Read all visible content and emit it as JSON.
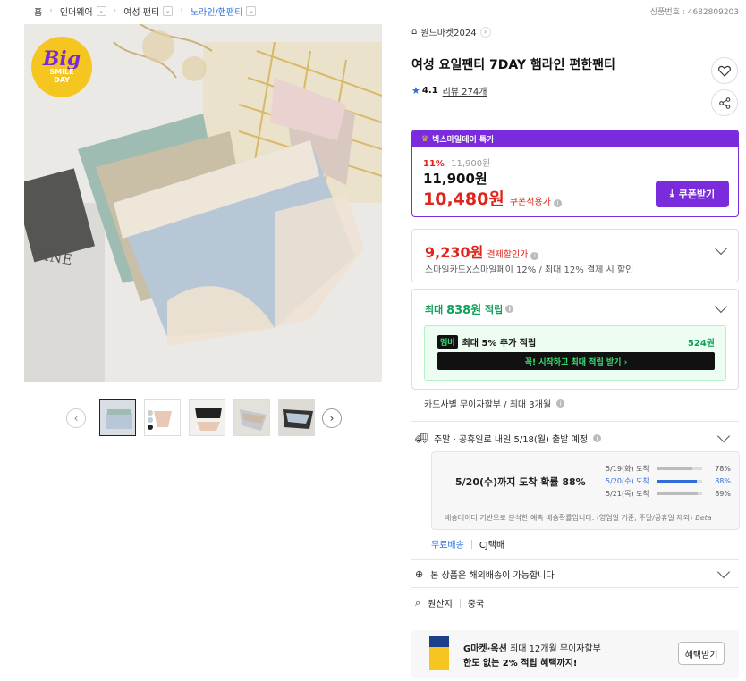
{
  "breadcrumb": [
    {
      "label": "홈"
    },
    {
      "label": "인더웨어"
    },
    {
      "label": "여성 팬티"
    },
    {
      "label": "노라인/햄팬티"
    }
  ],
  "product_number": "상품번호 : 4682809203",
  "badge": {
    "big": "Big",
    "line1": "SMILE",
    "line2": "DAY"
  },
  "shop": {
    "name": "원드마켓2024"
  },
  "title": "여성 요일팬티 7DAY 햄라인 편한팬티",
  "rating": {
    "score": "4.1",
    "reviews": "리뷰 274개"
  },
  "deal": {
    "header": "빅스마일데이 특가",
    "discount": "11%",
    "original": "11,900원",
    "price": "11,900원",
    "coupon_price": "10,480원",
    "coupon_label": "쿠폰적용가",
    "coupon_button": "쿠폰받기"
  },
  "payment": {
    "price": "9,230원",
    "label": "결제할인가",
    "desc": "스마일카드X스마일페이 12% / 최대 12% 결제 시 할인"
  },
  "points": {
    "prefix": "최대",
    "amount": "838원",
    "suffix": "적립",
    "member_logo": "멤버",
    "member_text": "최대 5% 추가 적립",
    "member_points": "524원",
    "member_button": "꼭! 시작하고 최대 적립 받기  ›"
  },
  "card_installment": "카드사별 무이자할부 / 최대 3개월",
  "shipping": {
    "headline": "주말 · 공휴일로 내일 5/18(월) 출발 예정",
    "probability": "5/20(수)까지 도착 확률 88%",
    "rows": [
      {
        "date": "5/19(화) 도착",
        "pct": "78%",
        "value": 0.78
      },
      {
        "date": "5/20(수) 도착",
        "pct": "88%",
        "value": 0.88
      },
      {
        "date": "5/21(목) 도착",
        "pct": "89%",
        "value": 0.89
      }
    ],
    "note": "배송데이터 기반으로 분석한 예측 배송확률입니다. (영업일 기준, 주말/공휴일 제외)",
    "beta": "Beta",
    "free": "무료배송",
    "carrier": "CJ택배"
  },
  "overseas": "본 상품은 해외배송이 가능합니다",
  "origin": {
    "label": "원산지",
    "value": "중국"
  },
  "promo": {
    "line1_bold": "G마켓·옥션",
    "line1_rest": " 최대 12개월 무이자할부",
    "line2": "한도 없는 2% 적립 혜택까지!",
    "button": "혜택받기"
  },
  "colors": {
    "purple": "#7a2bdc",
    "red": "#e0241b",
    "green": "#0fa05a",
    "blue": "#2f6ed9"
  }
}
